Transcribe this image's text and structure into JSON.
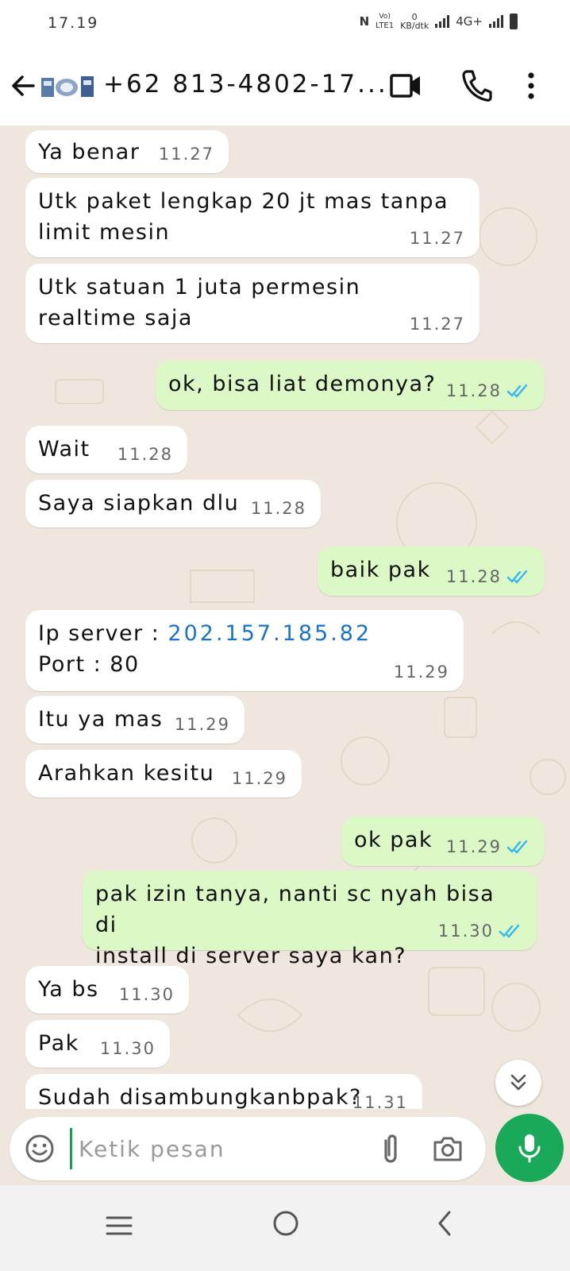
{
  "status_bar": {
    "time": "17.19",
    "nfc": "N",
    "volte_top": "Vo)",
    "volte_bottom": "LTE1",
    "speed_value": "0",
    "speed_unit": "KB/dtk",
    "network": "4G+"
  },
  "header": {
    "contact_name": "+62 813-4802-17..."
  },
  "messages": [
    {
      "dir": "in",
      "text": "Ya benar",
      "time": "11.27"
    },
    {
      "dir": "in",
      "text": "Utk paket lengkap 20 jt mas tanpa\nlimit mesin",
      "time": "11.27"
    },
    {
      "dir": "in",
      "text": "Utk satuan 1 juta permesin\nrealtime saja",
      "time": "11.27"
    },
    {
      "dir": "out",
      "text": "ok, bisa liat demonya?",
      "time": "11.28",
      "status": "read"
    },
    {
      "dir": "in",
      "text": "Wait",
      "time": "11.28"
    },
    {
      "dir": "in",
      "text": "Saya siapkan dlu",
      "time": "11.28"
    },
    {
      "dir": "out",
      "text": "baik pak",
      "time": "11.28",
      "status": "read"
    },
    {
      "dir": "in",
      "label_ip": "Ip server : ",
      "ip": "202.157.185.82",
      "text": "Port : 80",
      "time": "11.29"
    },
    {
      "dir": "in",
      "text": "Itu ya mas",
      "time": "11.29"
    },
    {
      "dir": "in",
      "text": "Arahkan kesitu",
      "time": "11.29"
    },
    {
      "dir": "out",
      "text": "ok pak",
      "time": "11.29",
      "status": "read"
    },
    {
      "dir": "out",
      "text": "pak izin tanya, nanti sc nyah bisa di\ninstall di server saya kan?",
      "time": "11.30",
      "status": "read"
    },
    {
      "dir": "in",
      "text": "Ya bs",
      "time": "11.30"
    },
    {
      "dir": "in",
      "text": "Pak",
      "time": "11.30"
    },
    {
      "dir": "in",
      "text": "Sudah disambungkanbpak?",
      "time": "11.31"
    }
  ],
  "input": {
    "placeholder": "Ketik pesan"
  },
  "colors": {
    "chat_bg": "#efe7dd",
    "incoming": "#ffffff",
    "outgoing": "#dcf8c6",
    "read_ticks": "#34b7f1",
    "accent": "#1aa959",
    "link": "#1a73c7"
  },
  "icons": [
    "back-arrow-icon",
    "video-call-icon",
    "phone-icon",
    "more-vert-icon",
    "emoji-icon",
    "attach-icon",
    "camera-icon",
    "mic-icon",
    "chevrons-down-icon"
  ]
}
